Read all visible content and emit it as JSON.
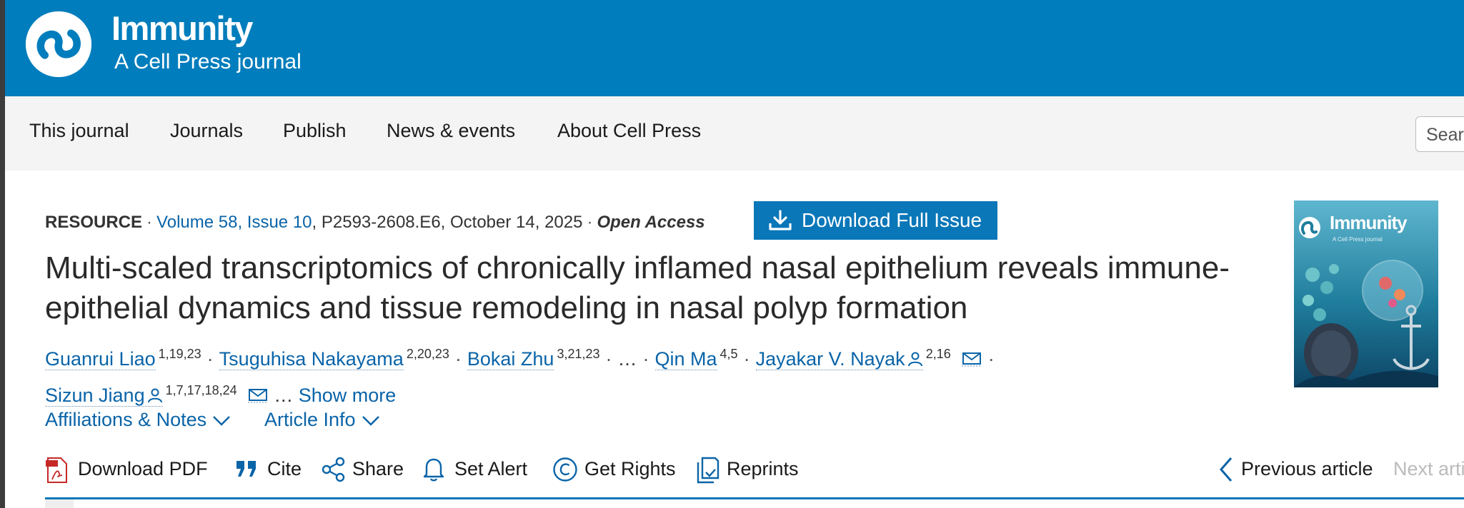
{
  "journal": {
    "name": "Immunity",
    "tagline": "A Cell Press journal"
  },
  "nav": {
    "items": [
      "This journal",
      "Journals",
      "Publish",
      "News & events",
      "About Cell Press"
    ],
    "search_placeholder": "Search"
  },
  "article_meta": {
    "type": "RESOURCE",
    "volume_issue": "Volume 58, Issue 10",
    "pages_date": "P2593-2608.E6, October 14, 2025",
    "access": "Open Access"
  },
  "download_issue_label": "Download Full Issue",
  "title": "Multi-scaled transcriptomics of chronically inflamed nasal epithelium reveals immune-epithelial dynamics and tissue remodeling in nasal polyp formation",
  "authors": [
    {
      "name": "Guanrui Liao",
      "sup": "1,19,23"
    },
    {
      "name": "Tsuguhisa Nakayama",
      "sup": "2,20,23"
    },
    {
      "name": "Bokai Zhu",
      "sup": "3,21,23"
    },
    {
      "name": "Qin Ma",
      "sup": "4,5"
    },
    {
      "name": "Jayakar V. Nayak",
      "sup": "2,16"
    },
    {
      "name": "Sizun Jiang",
      "sup": "1,7,17,18,24"
    }
  ],
  "ellipsis": "…",
  "show_more": "Show more",
  "toggles": {
    "affiliations": "Affiliations & Notes",
    "article_info": "Article Info"
  },
  "tools": {
    "download_pdf": "Download PDF",
    "cite": "Cite",
    "share": "Share",
    "set_alert": "Set Alert",
    "get_rights": "Get Rights",
    "reprints": "Reprints"
  },
  "article_nav": {
    "previous": "Previous article",
    "next": "Next article"
  },
  "cover": {
    "title": "Immunity",
    "subtitle": "A Cell Press journal"
  },
  "colors": {
    "header": "#007dbc",
    "link": "#0a64a8",
    "button": "#0a77b8",
    "nav_bg": "#f4f4f4"
  }
}
